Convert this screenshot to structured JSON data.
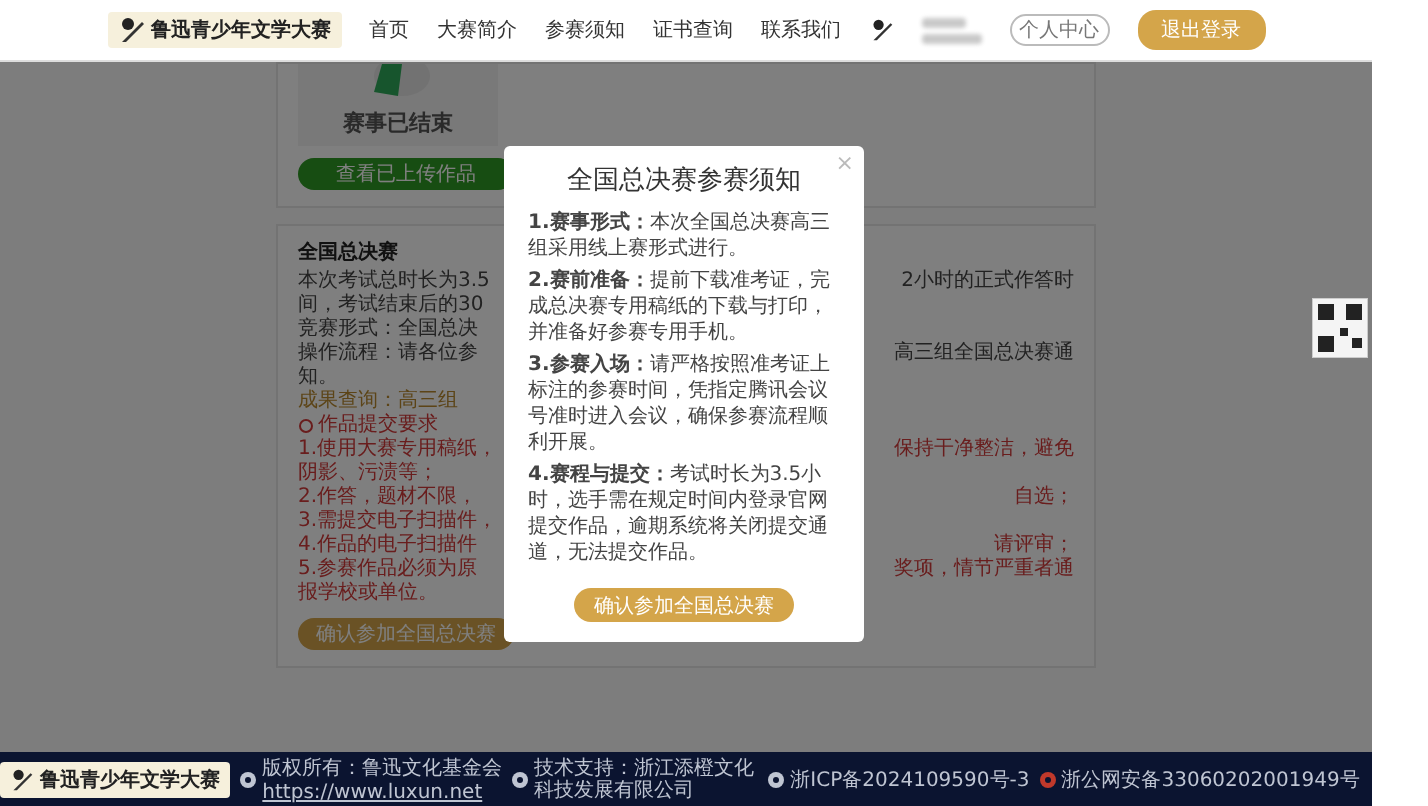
{
  "header": {
    "logo_text": "鲁迅青少年文学大赛",
    "nav": [
      {
        "label": "首页"
      },
      {
        "label": "大赛简介"
      },
      {
        "label": "参赛须知"
      },
      {
        "label": "证书查询"
      },
      {
        "label": "联系我们"
      }
    ],
    "user_badge": "个人中心",
    "logout": "退出登录"
  },
  "status_card": {
    "status": "赛事已结束",
    "button": "查看已上传作品"
  },
  "final_card": {
    "title": "全国总决赛",
    "rows": [
      {
        "kind": "text",
        "left": "本次考试总时长为3.5",
        "right": "2小时的正式作答时"
      },
      {
        "kind": "text",
        "left": "间，考试结束后的30"
      },
      {
        "kind": "text",
        "left": "竞赛形式：全国总决"
      },
      {
        "kind": "text",
        "left": "操作流程：请各位参",
        "right": "高三组全国总决赛通"
      },
      {
        "kind": "text",
        "left": "知。"
      },
      {
        "kind": "note",
        "left": "成果查询：高三组"
      },
      {
        "kind": "heading",
        "left": "作品提交要求"
      },
      {
        "kind": "alert",
        "left": "1.使用大赛专用稿纸，",
        "right": "保持干净整洁，避免"
      },
      {
        "kind": "alert",
        "left": "阴影、污渍等；"
      },
      {
        "kind": "alert",
        "left": "2.作答，题材不限，",
        "right": "自选；"
      },
      {
        "kind": "alert",
        "left": "3.需提交电子扫描件，"
      },
      {
        "kind": "alert",
        "left": "4.作品的电子扫描件",
        "right": "请评审；"
      },
      {
        "kind": "alert",
        "left": "5.参赛作品必须为原",
        "right": "奖项，情节严重者通"
      },
      {
        "kind": "alert",
        "left": "报学校或单位。"
      }
    ],
    "button": "确认参加全国总决赛"
  },
  "modal": {
    "title": "全国总决赛参赛须知",
    "close": "×",
    "paragraphs": [
      "**1.赛事形式：**本次全国总决赛高三组采用线上赛形式进行。",
      "**2.赛前准备：**提前下载准考证，完成总决赛专用稿纸的下载与打印，并准备好参赛专用手机。",
      "**3.参赛入场：**请严格按照准考证上标注的参赛时间，凭指定腾讯会议号准时进入会议，确保参赛流程顺利开展。",
      "**4.赛程与提交：**考试时长为3.5小时，选手需在规定时间内登录官网提交作品，逾期系统将关闭提交通道，无法提交作品。"
    ],
    "button": "确认参加全国总决赛"
  },
  "footer": {
    "logo_text": "鲁迅青少年文学大赛",
    "copyright": "版权所有：鲁迅文化基金会",
    "link": "https://www.luxun.net",
    "tech": "技术支持：浙江添橙文化科技发展有限公司",
    "icp": "浙ICP备2024109590号-3",
    "police": "浙公网安备33060202001949号"
  }
}
